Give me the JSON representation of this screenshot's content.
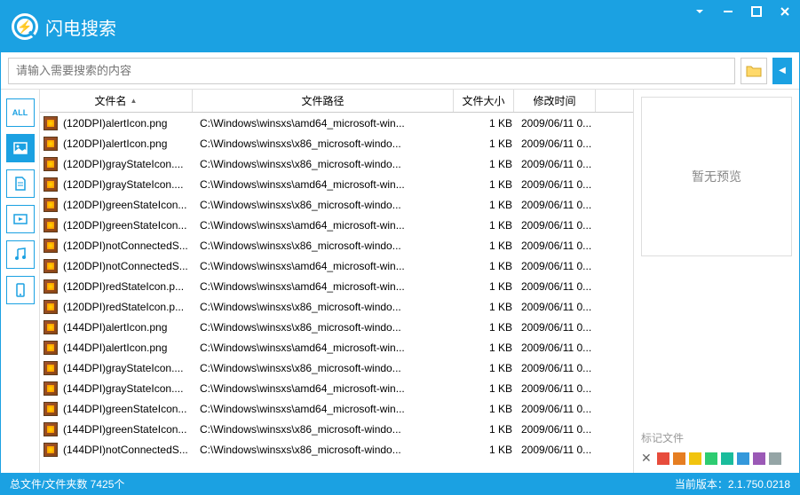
{
  "app": {
    "title": "闪电搜索"
  },
  "search": {
    "placeholder": "请输入需要搜索的内容"
  },
  "sidebar": [
    {
      "label": "ALL",
      "name": "filter-all"
    },
    {
      "label": "IMG",
      "name": "filter-image",
      "active": true
    },
    {
      "label": "DOC",
      "name": "filter-document"
    },
    {
      "label": "VID",
      "name": "filter-video"
    },
    {
      "label": "MUS",
      "name": "filter-music"
    },
    {
      "label": "MOB",
      "name": "filter-mobile"
    }
  ],
  "columns": {
    "name": "文件名",
    "path": "文件路径",
    "size": "文件大小",
    "date": "修改时间"
  },
  "rows": [
    {
      "name": "(120DPI)alertIcon.png",
      "path": "C:\\Windows\\winsxs\\amd64_microsoft-win...",
      "size": "1 KB",
      "date": "2009/06/11 0..."
    },
    {
      "name": "(120DPI)alertIcon.png",
      "path": "C:\\Windows\\winsxs\\x86_microsoft-windo...",
      "size": "1 KB",
      "date": "2009/06/11 0..."
    },
    {
      "name": "(120DPI)grayStateIcon....",
      "path": "C:\\Windows\\winsxs\\x86_microsoft-windo...",
      "size": "1 KB",
      "date": "2009/06/11 0..."
    },
    {
      "name": "(120DPI)grayStateIcon....",
      "path": "C:\\Windows\\winsxs\\amd64_microsoft-win...",
      "size": "1 KB",
      "date": "2009/06/11 0..."
    },
    {
      "name": "(120DPI)greenStateIcon...",
      "path": "C:\\Windows\\winsxs\\x86_microsoft-windo...",
      "size": "1 KB",
      "date": "2009/06/11 0..."
    },
    {
      "name": "(120DPI)greenStateIcon...",
      "path": "C:\\Windows\\winsxs\\amd64_microsoft-win...",
      "size": "1 KB",
      "date": "2009/06/11 0..."
    },
    {
      "name": "(120DPI)notConnectedS...",
      "path": "C:\\Windows\\winsxs\\x86_microsoft-windo...",
      "size": "1 KB",
      "date": "2009/06/11 0..."
    },
    {
      "name": "(120DPI)notConnectedS...",
      "path": "C:\\Windows\\winsxs\\amd64_microsoft-win...",
      "size": "1 KB",
      "date": "2009/06/11 0..."
    },
    {
      "name": "(120DPI)redStateIcon.p...",
      "path": "C:\\Windows\\winsxs\\amd64_microsoft-win...",
      "size": "1 KB",
      "date": "2009/06/11 0..."
    },
    {
      "name": "(120DPI)redStateIcon.p...",
      "path": "C:\\Windows\\winsxs\\x86_microsoft-windo...",
      "size": "1 KB",
      "date": "2009/06/11 0..."
    },
    {
      "name": "(144DPI)alertIcon.png",
      "path": "C:\\Windows\\winsxs\\x86_microsoft-windo...",
      "size": "1 KB",
      "date": "2009/06/11 0..."
    },
    {
      "name": "(144DPI)alertIcon.png",
      "path": "C:\\Windows\\winsxs\\amd64_microsoft-win...",
      "size": "1 KB",
      "date": "2009/06/11 0..."
    },
    {
      "name": "(144DPI)grayStateIcon....",
      "path": "C:\\Windows\\winsxs\\x86_microsoft-windo...",
      "size": "1 KB",
      "date": "2009/06/11 0..."
    },
    {
      "name": "(144DPI)grayStateIcon....",
      "path": "C:\\Windows\\winsxs\\amd64_microsoft-win...",
      "size": "1 KB",
      "date": "2009/06/11 0..."
    },
    {
      "name": "(144DPI)greenStateIcon...",
      "path": "C:\\Windows\\winsxs\\amd64_microsoft-win...",
      "size": "1 KB",
      "date": "2009/06/11 0..."
    },
    {
      "name": "(144DPI)greenStateIcon...",
      "path": "C:\\Windows\\winsxs\\x86_microsoft-windo...",
      "size": "1 KB",
      "date": "2009/06/11 0..."
    },
    {
      "name": "(144DPI)notConnectedS...",
      "path": "C:\\Windows\\winsxs\\x86_microsoft-windo...",
      "size": "1 KB",
      "date": "2009/06/11 0..."
    }
  ],
  "preview": {
    "empty_text": "暂无预览"
  },
  "tags": {
    "label": "标记文件",
    "colors": [
      "#e74c3c",
      "#e67e22",
      "#f1c40f",
      "#2ecc71",
      "#1abc9c",
      "#3498db",
      "#9b59b6",
      "#95a5a6"
    ]
  },
  "status": {
    "left": "总文件/文件夹数 7425个",
    "right": "当前版本：2.1.750.0218"
  }
}
